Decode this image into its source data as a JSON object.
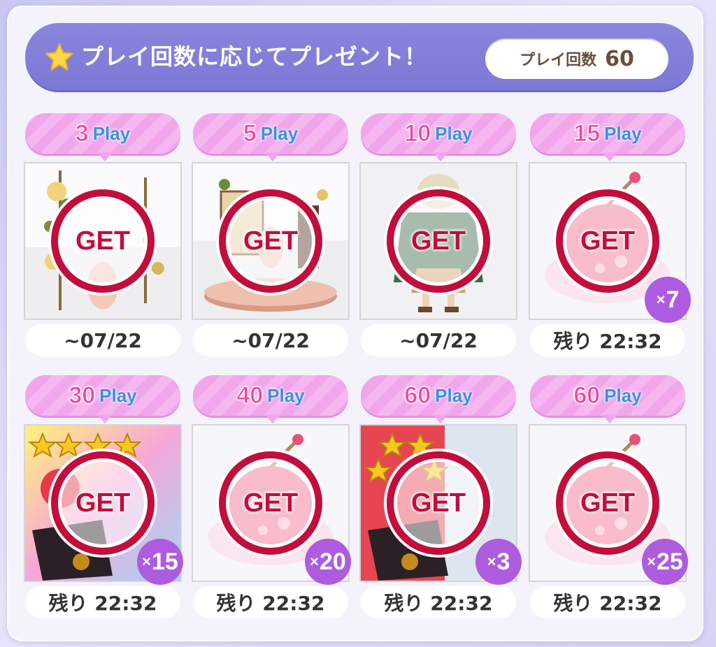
{
  "header": {
    "title": "プレイ回数に応じてプレゼント！",
    "count_label": "プレイ回数",
    "count_value": "60",
    "icon": "star-icon"
  },
  "colors": {
    "accent": "#7c78d6",
    "tag_pink": "#f6b7f1",
    "get_red": "#c20d3d",
    "qty_purple": "#ad5ce0"
  },
  "rewards": [
    {
      "play_num": "3",
      "play_label": "Play",
      "get_label": "GET",
      "qty": "",
      "footer": "~07/22",
      "item": "ornament-frame"
    },
    {
      "play_num": "5",
      "play_label": "Play",
      "get_label": "GET",
      "qty": "",
      "footer": "~07/22",
      "item": "easel-stage"
    },
    {
      "play_num": "10",
      "play_label": "Play",
      "get_label": "GET",
      "qty": "",
      "footer": "~07/22",
      "item": "outfit"
    },
    {
      "play_num": "15",
      "play_label": "Play",
      "get_label": "GET",
      "qty": "7",
      "footer": "残り 22:32",
      "item": "apple-candy"
    },
    {
      "play_num": "30",
      "play_label": "Play",
      "get_label": "GET",
      "qty": "15",
      "footer": "残り 22:32",
      "item": "star-ticket"
    },
    {
      "play_num": "40",
      "play_label": "Play",
      "get_label": "GET",
      "qty": "20",
      "footer": "残り 22:32",
      "item": "apple-candy"
    },
    {
      "play_num": "60",
      "play_label": "Play",
      "get_label": "GET",
      "qty": "3",
      "footer": "残り 22:32",
      "item": "star-ticket"
    },
    {
      "play_num": "60",
      "play_label": "Play",
      "get_label": "GET",
      "qty": "25",
      "footer": "残り 22:32",
      "item": "apple-candy"
    }
  ]
}
